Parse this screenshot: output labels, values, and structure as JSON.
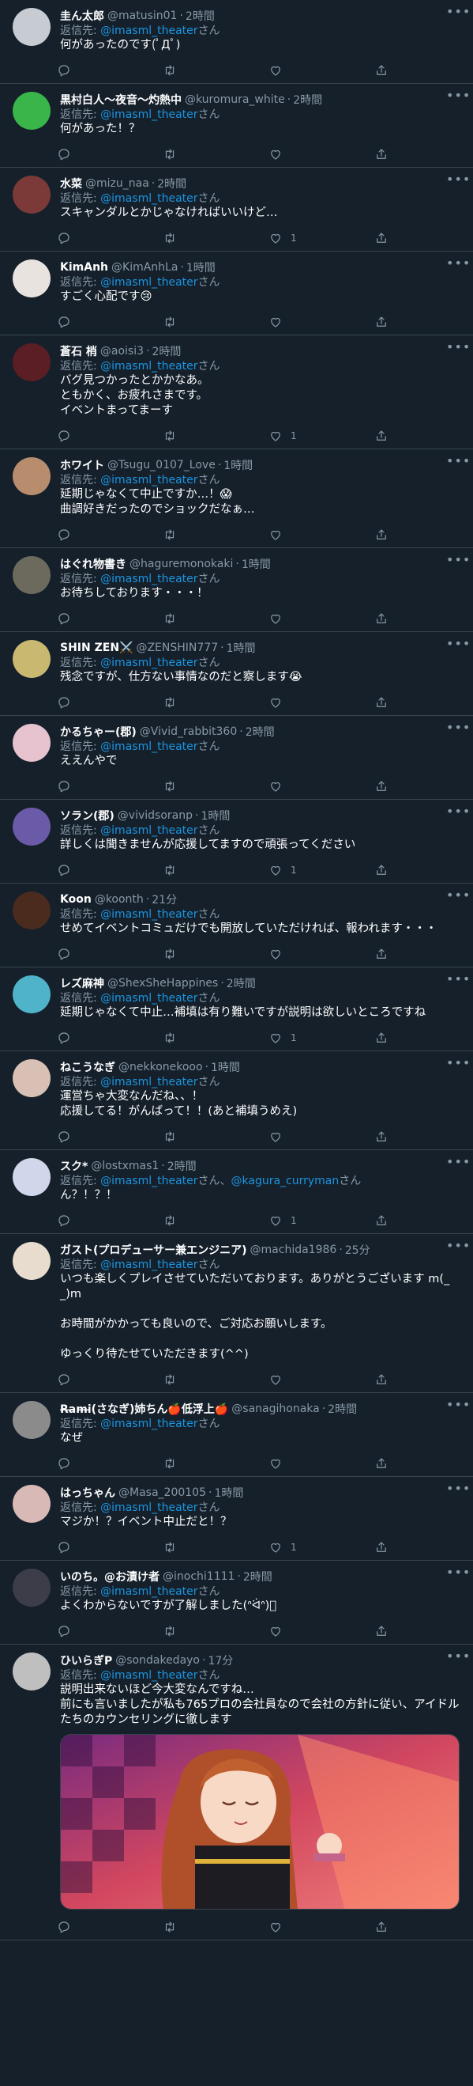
{
  "labels": {
    "reply_prefix": "返信先: ",
    "san": "さん",
    "and": "、"
  },
  "tweets": [
    {
      "name": "圭ん太郎",
      "handle": "@matusin01",
      "time": "2時間",
      "mentions": [
        "@imasml_theater"
      ],
      "text": "何があったのです(ﾟДﾟ)",
      "likes": "",
      "avatar_color": "#c7ccd3"
    },
    {
      "name": "黒村白人〜夜音〜灼熱中",
      "handle": "@kuromura_white",
      "time": "2時間",
      "mentions": [
        "@imasml_theater"
      ],
      "text": "何があった！？",
      "likes": "",
      "avatar_color": "#39b54a"
    },
    {
      "name": "水菜",
      "handle": "@mizu_naa",
      "time": "2時間",
      "mentions": [
        "@imasml_theater"
      ],
      "text": "スキャンダルとかじゃなければいいけど…",
      "likes": "1",
      "avatar_color": "#7b3a38"
    },
    {
      "name": "KimAnh",
      "handle": "@KimAnhLa",
      "time": "1時間",
      "mentions": [
        "@imasml_theater"
      ],
      "text": "すごく心配です😢",
      "likes": "",
      "avatar_color": "#e9e3df"
    },
    {
      "name": "蒼石 梢",
      "handle": "@aoisi3",
      "time": "2時間",
      "mentions": [
        "@imasml_theater"
      ],
      "text": "バグ見つかったとかかなあ。\nともかく、お疲れさまです。\nイベントまってまーす",
      "likes": "1",
      "avatar_color": "#5a1e24"
    },
    {
      "name": "ホワイト",
      "handle": "@Tsugu_0107_Love",
      "time": "1時間",
      "mentions": [
        "@imasml_theater"
      ],
      "text": "延期じゃなくて中止ですか…！😱\n曲調好きだったのでショックだなぁ…",
      "likes": "",
      "avatar_color": "#b88d6e"
    },
    {
      "name": "はぐれ物書き",
      "handle": "@haguremonokaki",
      "time": "1時間",
      "mentions": [
        "@imasml_theater"
      ],
      "text": "お待ちしております・・・！",
      "likes": "",
      "avatar_color": "#6b6a5c"
    },
    {
      "name": "SHIN ZEN⚔️",
      "handle": "@ZENSHIN777",
      "time": "1時間",
      "mentions": [
        "@imasml_theater"
      ],
      "text": "残念ですが、仕方ない事情なのだと察します😭",
      "likes": "",
      "avatar_color": "#c9b870"
    },
    {
      "name": "かるちゃー(郡)",
      "handle": "@Vivid_rabbit360",
      "time": "2時間",
      "mentions": [
        "@imasml_theater"
      ],
      "text": "ええんやで",
      "likes": "",
      "avatar_color": "#e6c3cf"
    },
    {
      "name": "ソラン(郡)",
      "handle": "@vividsoranp",
      "time": "1時間",
      "mentions": [
        "@imasml_theater"
      ],
      "text": "詳しくは聞きませんが応援してますので頑張ってください",
      "likes": "1",
      "avatar_color": "#6a5aa8"
    },
    {
      "name": "Koon",
      "handle": "@koonth",
      "time": "21分",
      "mentions": [
        "@imasml_theater"
      ],
      "text": "せめてイベントコミュだけでも開放していただければ、報われます・・・",
      "likes": "",
      "avatar_color": "#4a2b1e"
    },
    {
      "name": "レズ麻神",
      "handle": "@ShexSheHappines",
      "time": "2時間",
      "mentions": [
        "@imasml_theater"
      ],
      "text": "延期じゃなくて中止…補填は有り難いですが説明は欲しいところですね",
      "likes": "1",
      "avatar_color": "#4fb3c9"
    },
    {
      "name": "ねこうなぎ",
      "handle": "@nekkonekooo",
      "time": "1時間",
      "mentions": [
        "@imasml_theater"
      ],
      "text": "運営ちゃ大変なんだね、、！\n応援してる！がんばって！！(あと補填うめえ)",
      "likes": "",
      "avatar_color": "#d8c1b4"
    },
    {
      "name": "スク*",
      "handle": "@lostxmas1",
      "time": "2時間",
      "mentions": [
        "@imasml_theater",
        "@kagura_curryman"
      ],
      "text": "ん？！？！",
      "likes": "1",
      "avatar_color": "#d2d6ea"
    },
    {
      "name": "ガスト(プロデューサー兼エンジニア)",
      "handle": "@machida1986",
      "time": "25分",
      "mentions": [
        "@imasml_theater"
      ],
      "text": "いつも楽しくプレイさせていただいております。ありがとうございます m(_ _)m\n\nお時間がかかっても良いので、ご対応お願いします。\n\nゆっくり待たせていただきます(^^)",
      "likes": "",
      "avatar_color": "#e8dccf"
    },
    {
      "name": "R̶a̶m̶i̶(さなぎ)姉ちん🍎低浮上🍎",
      "handle": "@sanagihonaka",
      "time": "2時間",
      "mentions": [
        "@imasml_theater"
      ],
      "text": "なぜ",
      "likes": "",
      "avatar_color": "#8b8b8b"
    },
    {
      "name": "はっちゃん",
      "handle": "@Masa_200105",
      "time": "1時間",
      "mentions": [
        "@imasml_theater"
      ],
      "text": "マジか！？イベント中止だと！？",
      "likes": "1",
      "avatar_color": "#d9b9b6"
    },
    {
      "name": "いのち。@お漬け者",
      "handle": "@inochi1111",
      "time": "2時間",
      "mentions": [
        "@imasml_theater"
      ],
      "text": "よくわからないですが了解しました(ᐢᐛᐢ)ﾞ",
      "likes": "",
      "avatar_color": "#3d3d4a"
    },
    {
      "name": "ひいらぎP",
      "handle": "@sondakedayo",
      "time": "17分",
      "mentions": [
        "@imasml_theater"
      ],
      "text": "説明出来ないほど今大変なんですね…\n前にも言いましたが私も765プロの会社員なので会社の方針に従い、アイドルたちのカウンセリングに徹します",
      "likes": "",
      "avatar_color": "#bfbfbf",
      "has_media": true
    }
  ]
}
